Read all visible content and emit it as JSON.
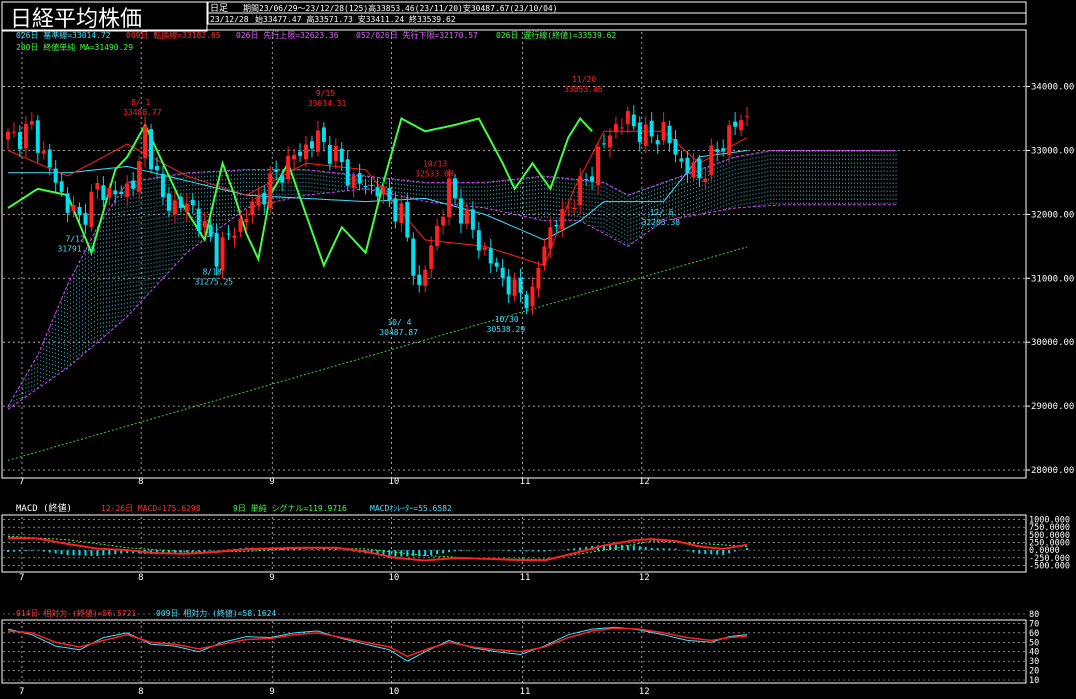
{
  "header": {
    "title": "日経平均株価",
    "timeframe": "日足",
    "period_info": "期間23/06/29～23/12/28(125)高33853.46(23/11/20)安30487.67(23/10/04)",
    "date": "23/12/28",
    "ohlc": "始33477.47 高33571.73 安33411.24 終33539.62"
  },
  "legend_price": {
    "kijun": "026日 基準線=33014.72",
    "tenkan": "009日 転換線=33182.65",
    "senkou_a": "026日 先行上限=32623.36",
    "senkou_b": "052/026日 先行下限=32170.57",
    "chikou": "026日 遅行線(終値)=33539.62",
    "ma": "200日 終値単純 MA=31490.29"
  },
  "legend_macd": {
    "title": "MACD (終値)",
    "macd": "12-26日 MACD=175.6298",
    "signal": "9日 単純 シグナル=119.9716",
    "osc": "MACDｵｼﾚｰﾀｰ=55.6582"
  },
  "legend_rsi": {
    "rsi14": "014日 相対力 (終値)=56.5721",
    "rsi9": "009日 相対力 (終値)=58.1624"
  },
  "colors": {
    "up": "#ff2020",
    "down": "#00e0f0",
    "kijun": "#40e0ff",
    "tenkan": "#ff2020",
    "chikou": "#40ff40",
    "cloud": "#40e8ff",
    "cloud_edge": "#e040ff",
    "ma": "#30d030",
    "grid": "#c8c8c8"
  },
  "month_labels": [
    "7",
    "8",
    "9",
    "10",
    "11",
    "12"
  ],
  "annotations": [
    {
      "date": "7/12",
      "value": "31791.71"
    },
    {
      "date": "8/ 1",
      "value": "33488.77"
    },
    {
      "date": "8/18",
      "value": "31275.25"
    },
    {
      "date": "9/15",
      "value": "33634.31"
    },
    {
      "date": "10/ 4",
      "value": "30487.87"
    },
    {
      "date": "10/13",
      "value": "32533.08"
    },
    {
      "date": "10/30",
      "value": "30538.29"
    },
    {
      "date": "11/20",
      "value": "33853.46"
    },
    {
      "date": "12/ 6",
      "value": "32205.38"
    }
  ],
  "chart_data": [
    {
      "type": "candlestick",
      "title": "日経平均株価",
      "ylim": [
        28000,
        34400
      ],
      "yticks": [
        "34000.00",
        "33000.00",
        "32000.00",
        "31000.00",
        "30000.00",
        "29000.00",
        "28000.00"
      ],
      "series_note": "daily OHLC 2023-06-29 to 2023-12-28 (125 sessions)",
      "anchors": [
        {
          "i": 1,
          "v": 33200
        },
        {
          "i": 4,
          "v": 33350
        },
        {
          "i": 9,
          "v": 32300
        },
        {
          "i": 12,
          "v": 31900
        },
        {
          "i": 15,
          "v": 32400
        },
        {
          "i": 19,
          "v": 32300
        },
        {
          "i": 22,
          "v": 32700
        },
        {
          "i": 23,
          "v": 33300
        },
        {
          "i": 26,
          "v": 32200
        },
        {
          "i": 31,
          "v": 32100
        },
        {
          "i": 35,
          "v": 31400
        },
        {
          "i": 40,
          "v": 32000
        },
        {
          "i": 45,
          "v": 32600
        },
        {
          "i": 48,
          "v": 32900
        },
        {
          "i": 52,
          "v": 33200
        },
        {
          "i": 55,
          "v": 32900
        },
        {
          "i": 58,
          "v": 32500
        },
        {
          "i": 62,
          "v": 32400
        },
        {
          "i": 66,
          "v": 32000
        },
        {
          "i": 69,
          "v": 30800
        },
        {
          "i": 71,
          "v": 31500
        },
        {
          "i": 74,
          "v": 32400
        },
        {
          "i": 77,
          "v": 31900
        },
        {
          "i": 80,
          "v": 31400
        },
        {
          "i": 83,
          "v": 31000
        },
        {
          "i": 85,
          "v": 30800
        },
        {
          "i": 88,
          "v": 30700
        },
        {
          "i": 90,
          "v": 31600
        },
        {
          "i": 93,
          "v": 32000
        },
        {
          "i": 96,
          "v": 32400
        },
        {
          "i": 98,
          "v": 32700
        },
        {
          "i": 101,
          "v": 33300
        },
        {
          "i": 104,
          "v": 33500
        },
        {
          "i": 107,
          "v": 33200
        },
        {
          "i": 110,
          "v": 33300
        },
        {
          "i": 113,
          "v": 32800
        },
        {
          "i": 116,
          "v": 32600
        },
        {
          "i": 119,
          "v": 33000
        },
        {
          "i": 122,
          "v": 33400
        },
        {
          "i": 124,
          "v": 33540
        }
      ],
      "kijun": [
        {
          "i": 0,
          "v": 32650
        },
        {
          "i": 10,
          "v": 32650
        },
        {
          "i": 20,
          "v": 32750
        },
        {
          "i": 40,
          "v": 32300
        },
        {
          "i": 60,
          "v": 32200
        },
        {
          "i": 70,
          "v": 32250
        },
        {
          "i": 80,
          "v": 32000
        },
        {
          "i": 90,
          "v": 31600
        },
        {
          "i": 96,
          "v": 31900
        },
        {
          "i": 100,
          "v": 32200
        },
        {
          "i": 110,
          "v": 32200
        },
        {
          "i": 116,
          "v": 32900
        },
        {
          "i": 124,
          "v": 33000
        }
      ],
      "tenkan": [
        {
          "i": 0,
          "v": 33000
        },
        {
          "i": 10,
          "v": 32600
        },
        {
          "i": 20,
          "v": 33100
        },
        {
          "i": 30,
          "v": 32600
        },
        {
          "i": 40,
          "v": 32300
        },
        {
          "i": 50,
          "v": 32800
        },
        {
          "i": 60,
          "v": 32700
        },
        {
          "i": 70,
          "v": 31600
        },
        {
          "i": 80,
          "v": 31500
        },
        {
          "i": 90,
          "v": 31200
        },
        {
          "i": 95,
          "v": 32400
        },
        {
          "i": 100,
          "v": 33300
        },
        {
          "i": 110,
          "v": 33300
        },
        {
          "i": 116,
          "v": 32800
        },
        {
          "i": 124,
          "v": 33200
        }
      ],
      "chikou": [
        {
          "i": 0,
          "v": 32100
        },
        {
          "i": 5,
          "v": 32400
        },
        {
          "i": 10,
          "v": 32300
        },
        {
          "i": 14,
          "v": 31400
        },
        {
          "i": 18,
          "v": 32700
        },
        {
          "i": 20,
          "v": 32900
        },
        {
          "i": 23,
          "v": 33400
        },
        {
          "i": 26,
          "v": 32800
        },
        {
          "i": 29,
          "v": 32200
        },
        {
          "i": 33,
          "v": 31600
        },
        {
          "i": 36,
          "v": 32800
        },
        {
          "i": 38,
          "v": 32300
        },
        {
          "i": 40,
          "v": 31700
        },
        {
          "i": 42,
          "v": 31300
        },
        {
          "i": 44,
          "v": 32300
        },
        {
          "i": 47,
          "v": 32800
        },
        {
          "i": 50,
          "v": 32000
        },
        {
          "i": 53,
          "v": 31200
        },
        {
          "i": 56,
          "v": 31800
        },
        {
          "i": 60,
          "v": 31400
        },
        {
          "i": 63,
          "v": 32500
        },
        {
          "i": 66,
          "v": 33500
        },
        {
          "i": 70,
          "v": 33300
        },
        {
          "i": 75,
          "v": 33400
        },
        {
          "i": 79,
          "v": 33500
        },
        {
          "i": 83,
          "v": 32800
        },
        {
          "i": 85,
          "v": 32400
        },
        {
          "i": 88,
          "v": 32800
        },
        {
          "i": 91,
          "v": 32400
        },
        {
          "i": 94,
          "v": 33200
        },
        {
          "i": 96,
          "v": 33500
        },
        {
          "i": 98,
          "v": 33300
        }
      ],
      "senkou_a": [
        {
          "i": 0,
          "v": 29000
        },
        {
          "i": 5,
          "v": 29800
        },
        {
          "i": 10,
          "v": 30900
        },
        {
          "i": 15,
          "v": 31800
        },
        {
          "i": 20,
          "v": 32500
        },
        {
          "i": 30,
          "v": 32650
        },
        {
          "i": 40,
          "v": 32700
        },
        {
          "i": 50,
          "v": 32700
        },
        {
          "i": 60,
          "v": 32600
        },
        {
          "i": 70,
          "v": 32500
        },
        {
          "i": 80,
          "v": 32500
        },
        {
          "i": 90,
          "v": 32600
        },
        {
          "i": 100,
          "v": 32500
        },
        {
          "i": 104,
          "v": 32300
        },
        {
          "i": 110,
          "v": 32500
        },
        {
          "i": 116,
          "v": 32700
        },
        {
          "i": 122,
          "v": 32900
        },
        {
          "i": 128,
          "v": 33000
        },
        {
          "i": 137,
          "v": 33000
        },
        {
          "i": 149,
          "v": 33000
        }
      ],
      "senkou_b": [
        {
          "i": 0,
          "v": 28950
        },
        {
          "i": 10,
          "v": 29600
        },
        {
          "i": 20,
          "v": 30400
        },
        {
          "i": 30,
          "v": 31400
        },
        {
          "i": 40,
          "v": 32100
        },
        {
          "i": 50,
          "v": 32300
        },
        {
          "i": 60,
          "v": 32400
        },
        {
          "i": 70,
          "v": 32200
        },
        {
          "i": 80,
          "v": 32100
        },
        {
          "i": 90,
          "v": 31900
        },
        {
          "i": 96,
          "v": 31900
        },
        {
          "i": 100,
          "v": 31700
        },
        {
          "i": 104,
          "v": 31500
        },
        {
          "i": 110,
          "v": 31900
        },
        {
          "i": 116,
          "v": 32000
        },
        {
          "i": 122,
          "v": 32100
        },
        {
          "i": 130,
          "v": 32150
        },
        {
          "i": 149,
          "v": 32150
        }
      ],
      "ma200": [
        {
          "i": 0,
          "v": 28150
        },
        {
          "i": 124,
          "v": 31490
        }
      ]
    },
    {
      "type": "line",
      "title": "MACD (終値)",
      "ylim": [
        -650,
        1050
      ],
      "yticks": [
        "1000.000",
        "750.0000",
        "500.0000",
        "250.0000",
        "0.0000",
        "-250.000",
        "-500.000"
      ],
      "macd": [
        {
          "i": 0,
          "v": 400
        },
        {
          "i": 5,
          "v": 380
        },
        {
          "i": 10,
          "v": 200
        },
        {
          "i": 15,
          "v": 50
        },
        {
          "i": 20,
          "v": 0
        },
        {
          "i": 25,
          "v": -100
        },
        {
          "i": 30,
          "v": -120
        },
        {
          "i": 35,
          "v": -60
        },
        {
          "i": 40,
          "v": 30
        },
        {
          "i": 45,
          "v": 60
        },
        {
          "i": 50,
          "v": 80
        },
        {
          "i": 55,
          "v": 80
        },
        {
          "i": 60,
          "v": -50
        },
        {
          "i": 65,
          "v": -250
        },
        {
          "i": 70,
          "v": -340
        },
        {
          "i": 75,
          "v": -260
        },
        {
          "i": 80,
          "v": -280
        },
        {
          "i": 85,
          "v": -320
        },
        {
          "i": 90,
          "v": -340
        },
        {
          "i": 95,
          "v": -100
        },
        {
          "i": 100,
          "v": 150
        },
        {
          "i": 105,
          "v": 320
        },
        {
          "i": 108,
          "v": 360
        },
        {
          "i": 112,
          "v": 300
        },
        {
          "i": 116,
          "v": 120
        },
        {
          "i": 120,
          "v": 40
        },
        {
          "i": 124,
          "v": 176
        }
      ],
      "signal": [
        {
          "i": 0,
          "v": 450
        },
        {
          "i": 10,
          "v": 340
        },
        {
          "i": 20,
          "v": 80
        },
        {
          "i": 30,
          "v": -60
        },
        {
          "i": 40,
          "v": -40
        },
        {
          "i": 50,
          "v": 60
        },
        {
          "i": 60,
          "v": 40
        },
        {
          "i": 70,
          "v": -180
        },
        {
          "i": 80,
          "v": -280
        },
        {
          "i": 90,
          "v": -300
        },
        {
          "i": 100,
          "v": 0
        },
        {
          "i": 108,
          "v": 300
        },
        {
          "i": 116,
          "v": 220
        },
        {
          "i": 124,
          "v": 120
        }
      ]
    },
    {
      "type": "line",
      "title": "相対力",
      "ylim": [
        10,
        80
      ],
      "yticks": [
        "80",
        "70",
        "60",
        "50",
        "40",
        "30",
        "20",
        "10"
      ],
      "rsi14": [
        {
          "i": 0,
          "v": 62
        },
        {
          "i": 4,
          "v": 60
        },
        {
          "i": 8,
          "v": 50
        },
        {
          "i": 12,
          "v": 45
        },
        {
          "i": 16,
          "v": 52
        },
        {
          "i": 20,
          "v": 58
        },
        {
          "i": 24,
          "v": 50
        },
        {
          "i": 28,
          "v": 48
        },
        {
          "i": 32,
          "v": 43
        },
        {
          "i": 36,
          "v": 48
        },
        {
          "i": 40,
          "v": 53
        },
        {
          "i": 44,
          "v": 54
        },
        {
          "i": 48,
          "v": 58
        },
        {
          "i": 52,
          "v": 60
        },
        {
          "i": 56,
          "v": 55
        },
        {
          "i": 60,
          "v": 50
        },
        {
          "i": 64,
          "v": 45
        },
        {
          "i": 67,
          "v": 35
        },
        {
          "i": 70,
          "v": 42
        },
        {
          "i": 74,
          "v": 50
        },
        {
          "i": 78,
          "v": 45
        },
        {
          "i": 82,
          "v": 42
        },
        {
          "i": 86,
          "v": 40
        },
        {
          "i": 90,
          "v": 45
        },
        {
          "i": 94,
          "v": 55
        },
        {
          "i": 98,
          "v": 62
        },
        {
          "i": 102,
          "v": 65
        },
        {
          "i": 106,
          "v": 64
        },
        {
          "i": 110,
          "v": 60
        },
        {
          "i": 114,
          "v": 55
        },
        {
          "i": 118,
          "v": 52
        },
        {
          "i": 121,
          "v": 55
        },
        {
          "i": 124,
          "v": 56.6
        }
      ],
      "rsi9": [
        {
          "i": 0,
          "v": 64
        },
        {
          "i": 4,
          "v": 58
        },
        {
          "i": 8,
          "v": 46
        },
        {
          "i": 12,
          "v": 42
        },
        {
          "i": 16,
          "v": 55
        },
        {
          "i": 20,
          "v": 60
        },
        {
          "i": 24,
          "v": 48
        },
        {
          "i": 28,
          "v": 46
        },
        {
          "i": 32,
          "v": 40
        },
        {
          "i": 36,
          "v": 50
        },
        {
          "i": 40,
          "v": 56
        },
        {
          "i": 44,
          "v": 55
        },
        {
          "i": 48,
          "v": 60
        },
        {
          "i": 52,
          "v": 62
        },
        {
          "i": 56,
          "v": 54
        },
        {
          "i": 60,
          "v": 48
        },
        {
          "i": 64,
          "v": 42
        },
        {
          "i": 67,
          "v": 30
        },
        {
          "i": 70,
          "v": 40
        },
        {
          "i": 74,
          "v": 52
        },
        {
          "i": 78,
          "v": 44
        },
        {
          "i": 82,
          "v": 40
        },
        {
          "i": 86,
          "v": 37
        },
        {
          "i": 90,
          "v": 46
        },
        {
          "i": 94,
          "v": 58
        },
        {
          "i": 98,
          "v": 64
        },
        {
          "i": 102,
          "v": 66
        },
        {
          "i": 106,
          "v": 63
        },
        {
          "i": 110,
          "v": 58
        },
        {
          "i": 114,
          "v": 52
        },
        {
          "i": 118,
          "v": 50
        },
        {
          "i": 121,
          "v": 56
        },
        {
          "i": 124,
          "v": 58.2
        }
      ]
    }
  ]
}
